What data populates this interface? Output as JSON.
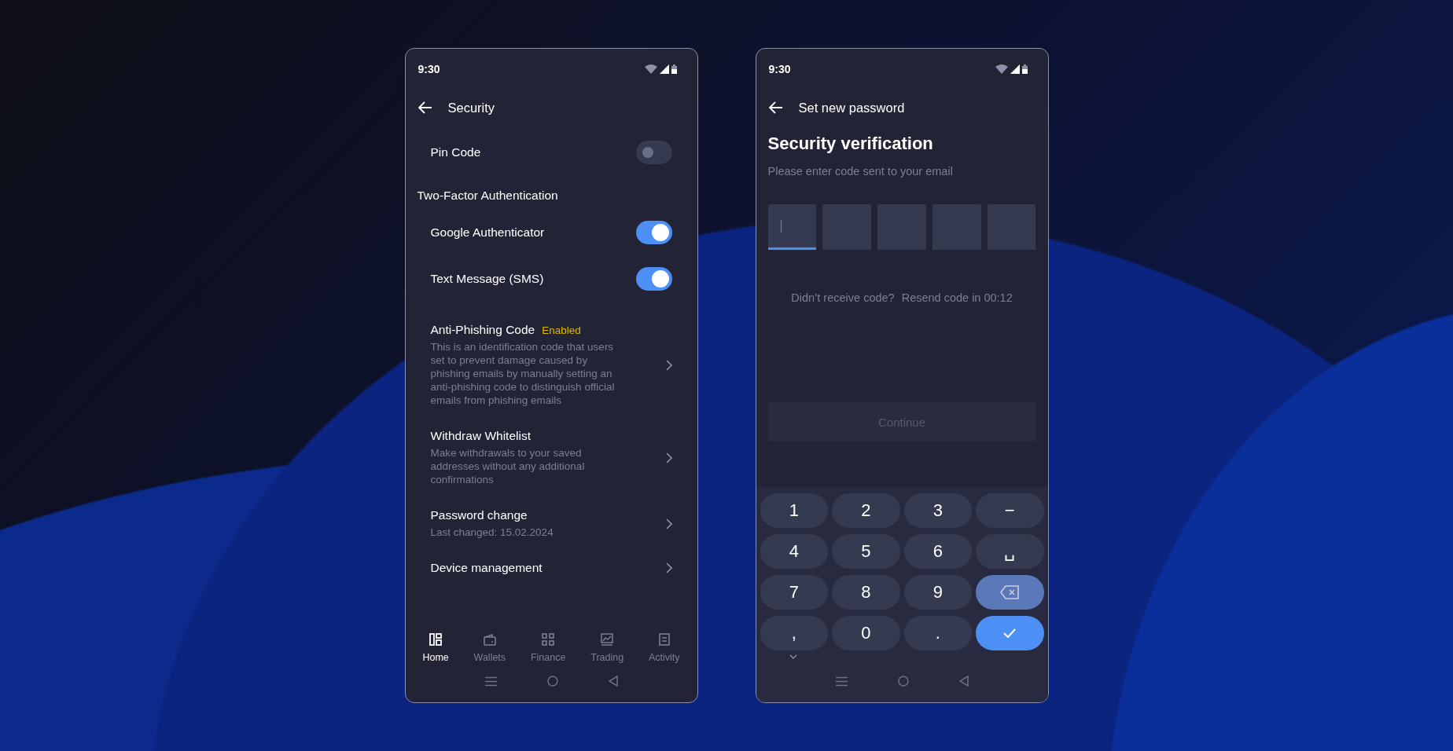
{
  "security_screen": {
    "status_bar": {
      "time": "9:30"
    },
    "title": "Security",
    "pin_code": {
      "label": "Pin Code",
      "on": false
    },
    "two_factor": {
      "title": "Two-Factor Authentication",
      "items": [
        {
          "label": "Google Authenticator",
          "on": true
        },
        {
          "label": "Text Message (SMS)",
          "on": true
        }
      ]
    },
    "menu_items": [
      {
        "title": "Anti-Phishing Code",
        "badge": "Enabled",
        "description": "This is an identification code that users set to prevent damage caused by phishing emails by manually setting an anti-phishing code to distinguish official emails from phishing emails"
      },
      {
        "title": "Withdraw Whitelist",
        "description": "Make withdrawals to your saved addresses without any additional confirmations"
      },
      {
        "title": "Password change",
        "description": "Last changed: 15.02.2024"
      },
      {
        "title": "Device management"
      }
    ],
    "bottom_nav": [
      {
        "label": "Home",
        "kind": "home",
        "selected": true
      },
      {
        "label": "Wallets",
        "kind": "wallet",
        "selected": false
      },
      {
        "label": "Finance",
        "kind": "grid",
        "selected": false
      },
      {
        "label": "Trading",
        "kind": "chart",
        "selected": false
      },
      {
        "label": "Activity",
        "kind": "document",
        "selected": false
      }
    ]
  },
  "verification_screen": {
    "status_bar": {
      "time": "9:30"
    },
    "title": "Set new password",
    "heading": "Security verification",
    "subtitle": "Please enter code sent to your email",
    "code_boxes": [
      {
        "focused": true
      },
      {
        "focused": false
      },
      {
        "focused": false
      },
      {
        "focused": false
      },
      {
        "focused": false
      }
    ],
    "resend": {
      "prompt": "Didn’t receive code?",
      "timer": "Resend code in 00:12"
    },
    "continue_button": {
      "label": "Continue",
      "disabled": true
    },
    "keypad": [
      {
        "kind": "char",
        "label": "1",
        "pressed": false
      },
      {
        "kind": "char",
        "label": "2",
        "pressed": false
      },
      {
        "kind": "char",
        "label": "3",
        "pressed": false
      },
      {
        "kind": "char",
        "label": "−",
        "pressed": false
      },
      {
        "kind": "char",
        "label": "4",
        "pressed": false
      },
      {
        "kind": "char",
        "label": "5",
        "pressed": false
      },
      {
        "kind": "char",
        "label": "6",
        "pressed": false
      },
      {
        "kind": "char",
        "label": "␣",
        "pressed": false
      },
      {
        "kind": "char",
        "label": "7",
        "pressed": false
      },
      {
        "kind": "char",
        "label": "8",
        "pressed": false
      },
      {
        "kind": "char",
        "label": "9",
        "pressed": false
      },
      {
        "kind": "backspace",
        "pressed": true
      },
      {
        "kind": "char",
        "label": ",",
        "pressed": false
      },
      {
        "kind": "char",
        "label": "0",
        "pressed": false
      },
      {
        "kind": "char",
        "label": ".",
        "pressed": false
      },
      {
        "kind": "enter",
        "pressed": false
      }
    ]
  }
}
